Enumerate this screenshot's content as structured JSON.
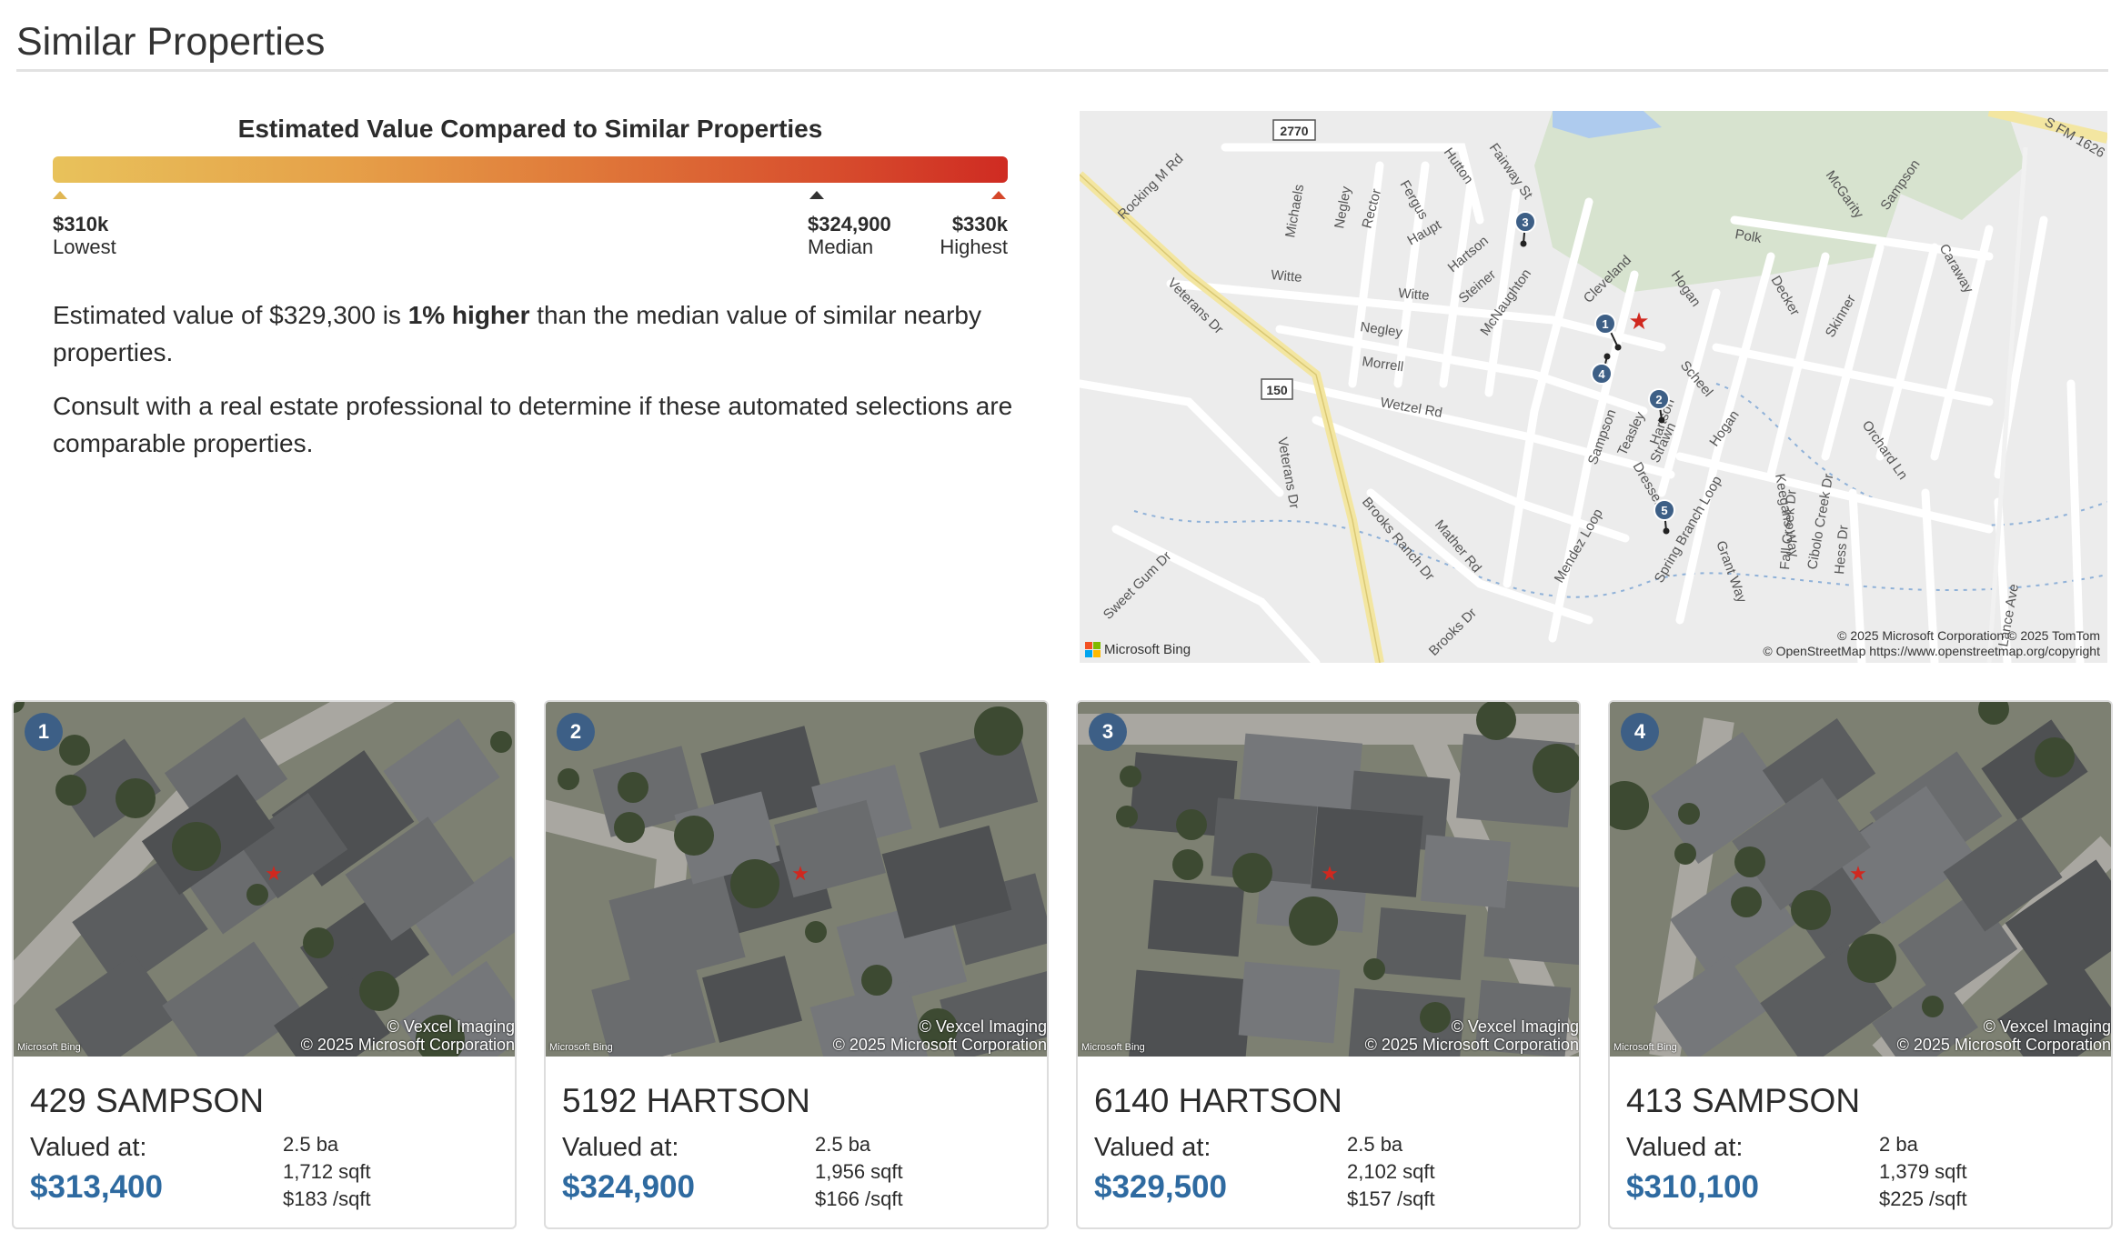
{
  "section": {
    "title": "Similar Properties"
  },
  "scale": {
    "heading": "Estimated Value Compared to Similar Properties",
    "lowest": {
      "value": "$310k",
      "label": "Lowest"
    },
    "median": {
      "value": "$324,900",
      "label": "Median"
    },
    "highest": {
      "value": "$330k",
      "label": "Highest"
    }
  },
  "description": {
    "line1_prefix": "Estimated value of $329,300 is ",
    "line1_bold": "1% higher",
    "line1_suffix": " than the median value of similar nearby properties.",
    "line2": "Consult with a real estate professional to determine if these automated selections are comparable properties."
  },
  "map": {
    "highway_labels": [
      "2770",
      "150"
    ],
    "street_labels": [
      "Rocking M Rd",
      "Michaels",
      "Negley",
      "Rector",
      "Fergus",
      "Hutton",
      "Fairway St",
      "McGarity",
      "Sampson",
      "Caraway",
      "S FM 1626",
      "Witte",
      "Witte",
      "Haupt",
      "Hartson",
      "Steiner",
      "McNaughton",
      "Cleveland",
      "Hogan",
      "Polk",
      "Decker",
      "Skinner",
      "Veterans Dr",
      "Negley",
      "Morrell",
      "Wetzel Rd",
      "Sampson",
      "Teasley",
      "Strawn",
      "Hartson",
      "Scheel",
      "Hogan",
      "Veterans Dr",
      "Brooks Ranch Dr",
      "Mather Rd",
      "Dresser",
      "Spring Branch Loop",
      "Keegans Way",
      "Fall Creek Dr",
      "Cibolo Creek Dr",
      "Hess Dr",
      "Orchard Ln",
      "Grant Way",
      "Mendez Loop",
      "Sweet Gum Dr",
      "Brooks Dr",
      "Lance Ave"
    ],
    "pin_labels": [
      "1",
      "2",
      "3",
      "4",
      "5"
    ],
    "logo": "Microsoft Bing",
    "credit_line1": "© 2025 Microsoft Corporation © 2025 TomTom",
    "credit_line2": "© OpenStreetMap https://www.openstreetmap.org/copyright",
    "colors": {
      "land": "#ececec",
      "park": "#d7e3cf",
      "water": "#aecbee",
      "road": "#ffffff",
      "highway": "#f3e6a1"
    }
  },
  "cards": [
    {
      "badge": "1",
      "address": "429 SAMPSON",
      "valued_label": "Valued at:",
      "price": "$313,400",
      "baths": "2.5 ba",
      "sqft": "1,712 sqft",
      "ppsf": "$183 /sqft"
    },
    {
      "badge": "2",
      "address": "5192 HARTSON",
      "valued_label": "Valued at:",
      "price": "$324,900",
      "baths": "2.5 ba",
      "sqft": "1,956 sqft",
      "ppsf": "$166 /sqft"
    },
    {
      "badge": "3",
      "address": "6140 HARTSON",
      "valued_label": "Valued at:",
      "price": "$329,500",
      "baths": "2.5 ba",
      "sqft": "2,102 sqft",
      "ppsf": "$157 /sqft"
    },
    {
      "badge": "4",
      "address": "413 SAMPSON",
      "valued_label": "Valued at:",
      "price": "$310,100",
      "baths": "2 ba",
      "sqft": "1,379 sqft",
      "ppsf": "$225 /sqft"
    }
  ],
  "photo_credit": {
    "line1": "© Vexcel Imaging",
    "line2": "© 2025 Microsoft Corporation",
    "logo": "Microsoft Bing"
  },
  "accent": {
    "price": "#2e6aa0",
    "badge": "#3d5f86",
    "target_star": "#d0281f"
  }
}
